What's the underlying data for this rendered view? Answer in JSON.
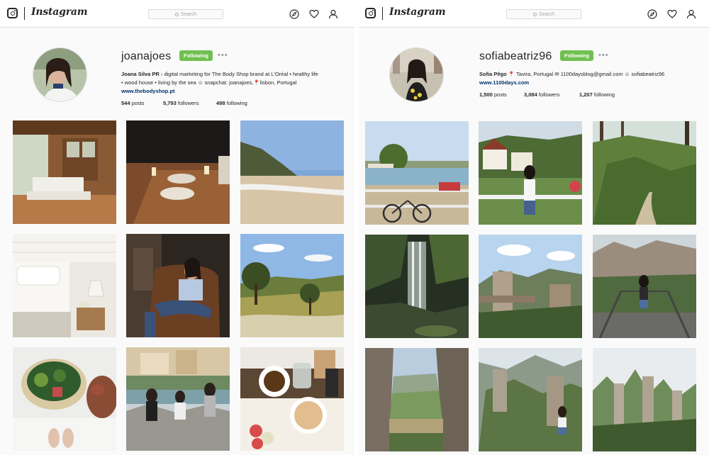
{
  "left": {
    "nav": {
      "wordmark": "Instagram",
      "search_placeholder": "Search"
    },
    "profile": {
      "username": "joanajoes",
      "follow_label": "Following",
      "more_label": "•••",
      "bio_name": "Joana Silva PR",
      "bio_line1": "› digital marketing for The Body Shop brand at L'Oréal • healthy life",
      "bio_line2": "• wood house • living by the sea ☺ snapchat: joanajoes,📍lisbon, Portugal",
      "website": "www.thebodyshop.pt",
      "posts_count": "544",
      "posts_label": "posts",
      "followers_count": "5,793",
      "followers_label": "followers",
      "following_count": "498",
      "following_label": "following"
    },
    "photos": [
      {
        "theme": "wood porch with white sofa"
      },
      {
        "theme": "night table with candles"
      },
      {
        "theme": "beach and sea"
      },
      {
        "theme": "white bedroom"
      },
      {
        "theme": "woman in leather chair"
      },
      {
        "theme": "green hills and tree"
      },
      {
        "theme": "vegetables basket"
      },
      {
        "theme": "three women on rocks"
      },
      {
        "theme": "breakfast with pancakes"
      }
    ]
  },
  "right": {
    "nav": {
      "wordmark": "Instagram",
      "search_placeholder": "Search"
    },
    "profile": {
      "username": "sofiabeatriz96",
      "follow_label": "Following",
      "more_label": "•••",
      "bio_name": "Sofia Pêgo",
      "bio_line1": "📍 Tavira, Portugal ✉ 1100daysblog@gmail.com ☺ sofiabeatriz96",
      "website": "www.1100days.com",
      "posts_count": "1,500",
      "posts_label": "posts",
      "followers_count": "3,084",
      "followers_label": "followers",
      "following_count": "1,207",
      "following_label": "following"
    },
    "photos": [
      {
        "theme": "lake with bicycle"
      },
      {
        "theme": "woman in village"
      },
      {
        "theme": "forest path"
      },
      {
        "theme": "waterfall cave"
      },
      {
        "theme": "rock bridge"
      },
      {
        "theme": "woman on viewpoint"
      },
      {
        "theme": "rock cliffs valley"
      },
      {
        "theme": "woman on rocks"
      },
      {
        "theme": "sandstone towers"
      }
    ]
  },
  "colors": {
    "following_green": "#70c050",
    "link_blue": "#003569",
    "border": "#dbdbdb"
  }
}
